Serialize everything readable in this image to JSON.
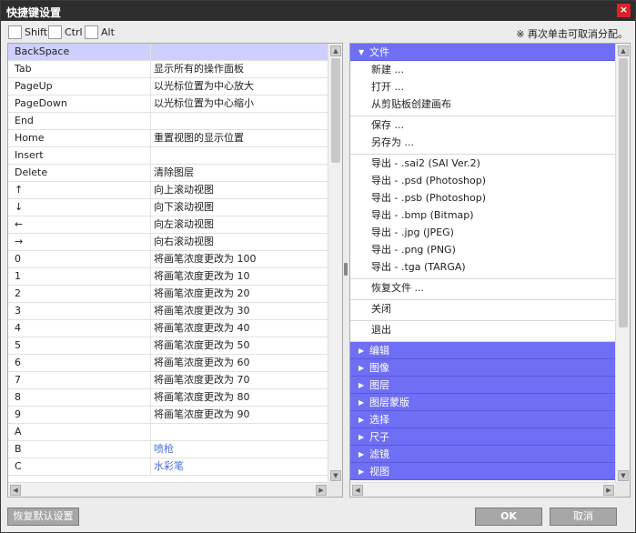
{
  "window": {
    "title": "快捷键设置",
    "close_label": "×"
  },
  "modifiers": [
    {
      "label": "Shift"
    },
    {
      "label": "Ctrl"
    },
    {
      "label": "Alt"
    }
  ],
  "hint": "※ 再次单击可取消分配。",
  "shortcuts": [
    {
      "key": "BackSpace",
      "action": "",
      "selected": true
    },
    {
      "key": "Tab",
      "action": "显示所有的操作面板"
    },
    {
      "key": "PageUp",
      "action": "以光标位置为中心放大"
    },
    {
      "key": "PageDown",
      "action": "以光标位置为中心缩小"
    },
    {
      "key": "End",
      "action": ""
    },
    {
      "key": "Home",
      "action": "重置视图的显示位置"
    },
    {
      "key": "Insert",
      "action": ""
    },
    {
      "key": "Delete",
      "action": "清除图层"
    },
    {
      "key": "↑",
      "action": "向上滚动视图"
    },
    {
      "key": "↓",
      "action": "向下滚动视图"
    },
    {
      "key": "←",
      "action": "向左滚动视图"
    },
    {
      "key": "→",
      "action": "向右滚动视图"
    },
    {
      "key": "0",
      "action": "将画笔浓度更改为 100"
    },
    {
      "key": "1",
      "action": "将画笔浓度更改为 10"
    },
    {
      "key": "2",
      "action": "将画笔浓度更改为 20"
    },
    {
      "key": "3",
      "action": "将画笔浓度更改为 30"
    },
    {
      "key": "4",
      "action": "将画笔浓度更改为 40"
    },
    {
      "key": "5",
      "action": "将画笔浓度更改为 50"
    },
    {
      "key": "6",
      "action": "将画笔浓度更改为 60"
    },
    {
      "key": "7",
      "action": "将画笔浓度更改为 70"
    },
    {
      "key": "8",
      "action": "将画笔浓度更改为 80"
    },
    {
      "key": "9",
      "action": "将画笔浓度更改为 90"
    },
    {
      "key": "A",
      "action": ""
    },
    {
      "key": "B",
      "action": "喷枪",
      "link": true
    },
    {
      "key": "C",
      "action": "水彩笔",
      "link": true
    }
  ],
  "menu": {
    "expanded": {
      "label": "文件",
      "groups": [
        [
          "新建 ...",
          "打开 ...",
          "从剪贴板创建画布"
        ],
        [
          "保存 ...",
          "另存为 ..."
        ],
        [
          "导出 - .sai2 (SAI Ver.2)",
          "导出 - .psd (Photoshop)",
          "导出 - .psb (Photoshop)",
          "导出 - .bmp (Bitmap)",
          "导出 - .jpg (JPEG)",
          "导出 - .png (PNG)",
          "导出 - .tga (TARGA)"
        ],
        [
          "恢复文件 ..."
        ],
        [
          "关闭"
        ],
        [
          "退出"
        ]
      ]
    },
    "collapsed": [
      "编辑",
      "图像",
      "图层",
      "图层蒙版",
      "选择",
      "尺子",
      "滤镜",
      "视图"
    ]
  },
  "buttons": {
    "restore": "恢复默认设置",
    "ok": "OK",
    "cancel": "取消"
  },
  "colors": {
    "category_bg": "#6f6ff5",
    "selected_row": "#cfcfff",
    "link": "#4a6fd8"
  }
}
